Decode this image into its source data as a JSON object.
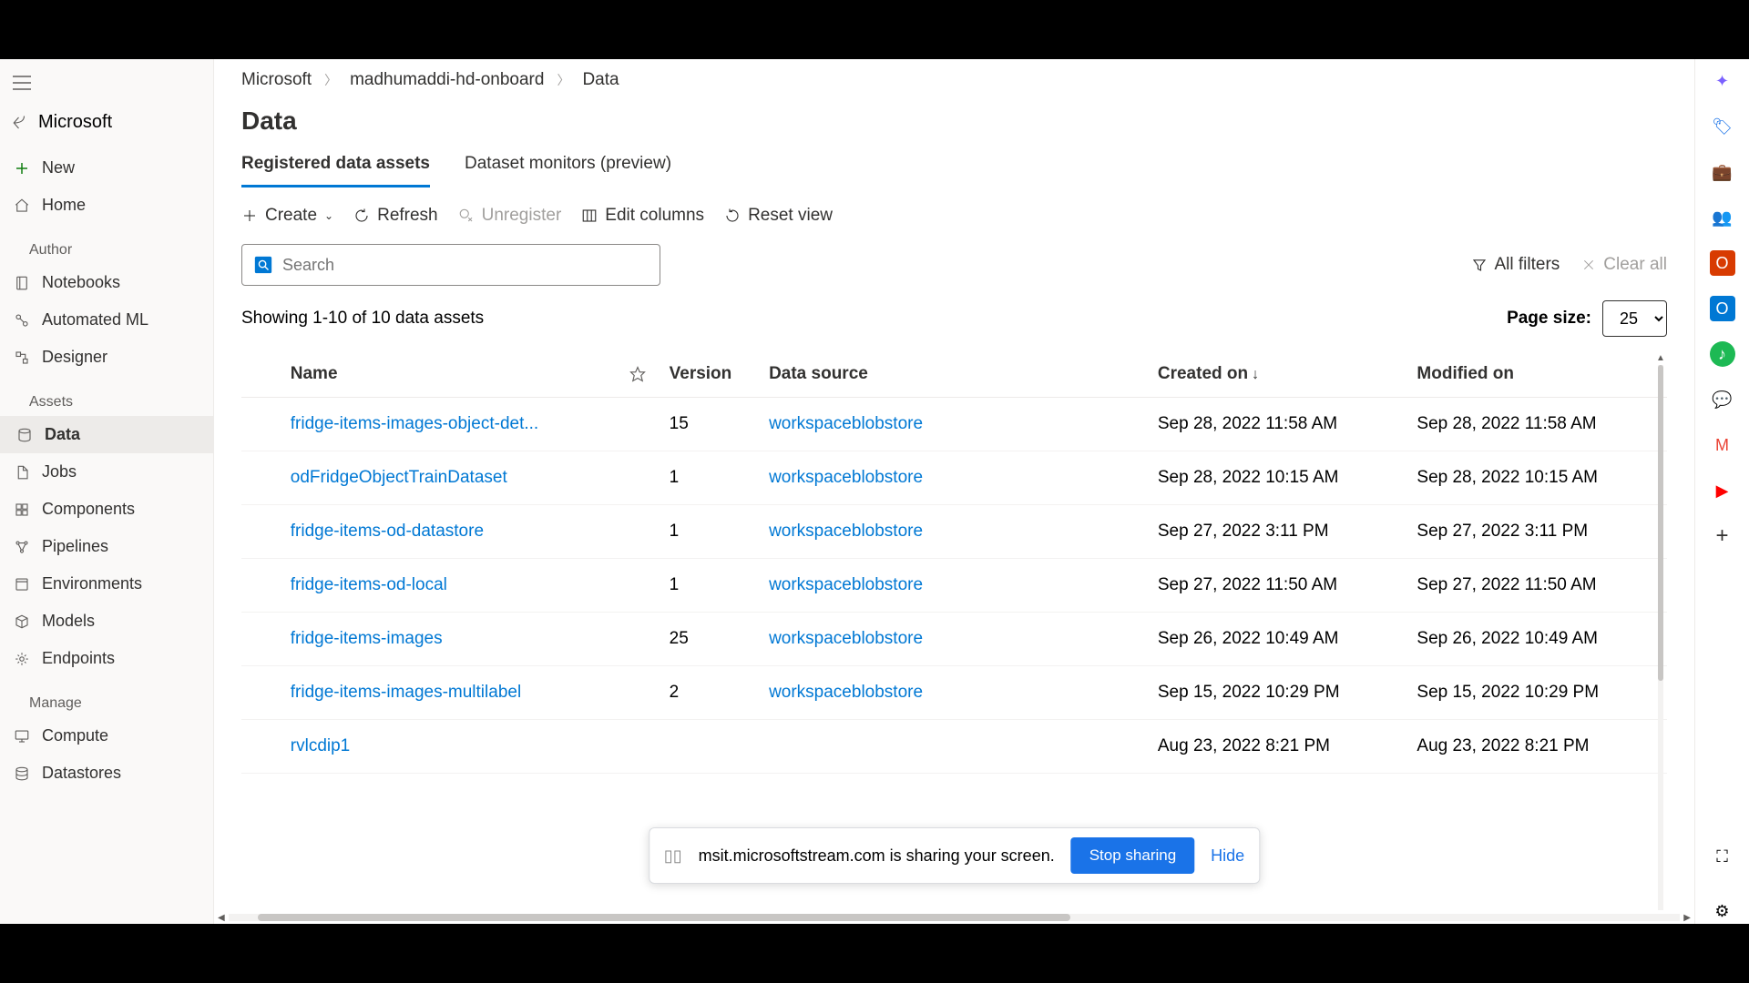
{
  "breadcrumb": {
    "item1": "Microsoft",
    "item2": "madhumaddi-hd-onboard",
    "item3": "Data"
  },
  "page_title": "Data",
  "back_label": "Microsoft",
  "sidebar": {
    "new": "New",
    "home": "Home",
    "sections": {
      "author": "Author",
      "assets": "Assets",
      "manage": "Manage"
    },
    "author_items": {
      "notebooks": "Notebooks",
      "automl": "Automated ML",
      "designer": "Designer"
    },
    "asset_items": {
      "data": "Data",
      "jobs": "Jobs",
      "components": "Components",
      "pipelines": "Pipelines",
      "environments": "Environments",
      "models": "Models",
      "endpoints": "Endpoints"
    },
    "manage_items": {
      "compute": "Compute",
      "datastores": "Datastores"
    }
  },
  "tabs": {
    "assets": "Registered data assets",
    "monitors": "Dataset monitors (preview)"
  },
  "toolbar": {
    "create": "Create",
    "refresh": "Refresh",
    "unregister": "Unregister",
    "edit_cols": "Edit columns",
    "reset": "Reset view"
  },
  "search": {
    "placeholder": "Search"
  },
  "filters": {
    "all": "All filters",
    "clear": "Clear all"
  },
  "showing": "Showing 1-10 of 10 data assets",
  "page_size_label": "Page size:",
  "page_size_value": "25",
  "columns": {
    "name": "Name",
    "version": "Version",
    "source": "Data source",
    "created": "Created on",
    "modified": "Modified on"
  },
  "rows": [
    {
      "name": "fridge-items-images-object-det...",
      "version": "15",
      "source": "workspaceblobstore",
      "created": "Sep 28, 2022 11:58 AM",
      "modified": "Sep 28, 2022 11:58 AM"
    },
    {
      "name": "odFridgeObjectTrainDataset",
      "version": "1",
      "source": "workspaceblobstore",
      "created": "Sep 28, 2022 10:15 AM",
      "modified": "Sep 28, 2022 10:15 AM"
    },
    {
      "name": "fridge-items-od-datastore",
      "version": "1",
      "source": "workspaceblobstore",
      "created": "Sep 27, 2022 3:11 PM",
      "modified": "Sep 27, 2022 3:11 PM"
    },
    {
      "name": "fridge-items-od-local",
      "version": "1",
      "source": "workspaceblobstore",
      "created": "Sep 27, 2022 11:50 AM",
      "modified": "Sep 27, 2022 11:50 AM"
    },
    {
      "name": "fridge-items-images",
      "version": "25",
      "source": "workspaceblobstore",
      "created": "Sep 26, 2022 10:49 AM",
      "modified": "Sep 26, 2022 10:49 AM"
    },
    {
      "name": "fridge-items-images-multilabel",
      "version": "2",
      "source": "workspaceblobstore",
      "created": "Sep 15, 2022 10:29 PM",
      "modified": "Sep 15, 2022 10:29 PM"
    },
    {
      "name": "rvlcdip1",
      "version": "",
      "source": "",
      "created": "Aug 23, 2022 8:21 PM",
      "modified": "Aug 23, 2022 8:21 PM"
    }
  ],
  "share": {
    "text": "msit.microsoftstream.com is sharing your screen.",
    "stop": "Stop sharing",
    "hide": "Hide"
  }
}
